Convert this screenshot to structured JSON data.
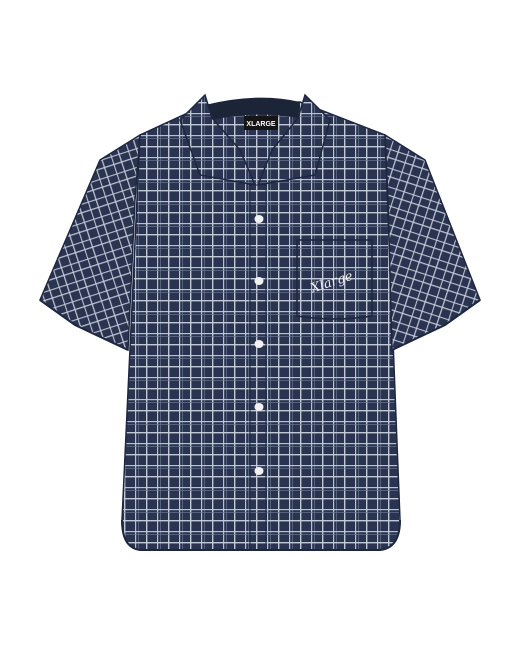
{
  "product": {
    "label_text": "XLARGE",
    "signature_text": "Xlarge",
    "colors": {
      "background": "#ffffff",
      "fabric": "#2a3450",
      "check_line": "#c9cfdc",
      "check_line_dim": "#6f7a95",
      "button": "#f1f1f1",
      "label": "#151515"
    }
  }
}
